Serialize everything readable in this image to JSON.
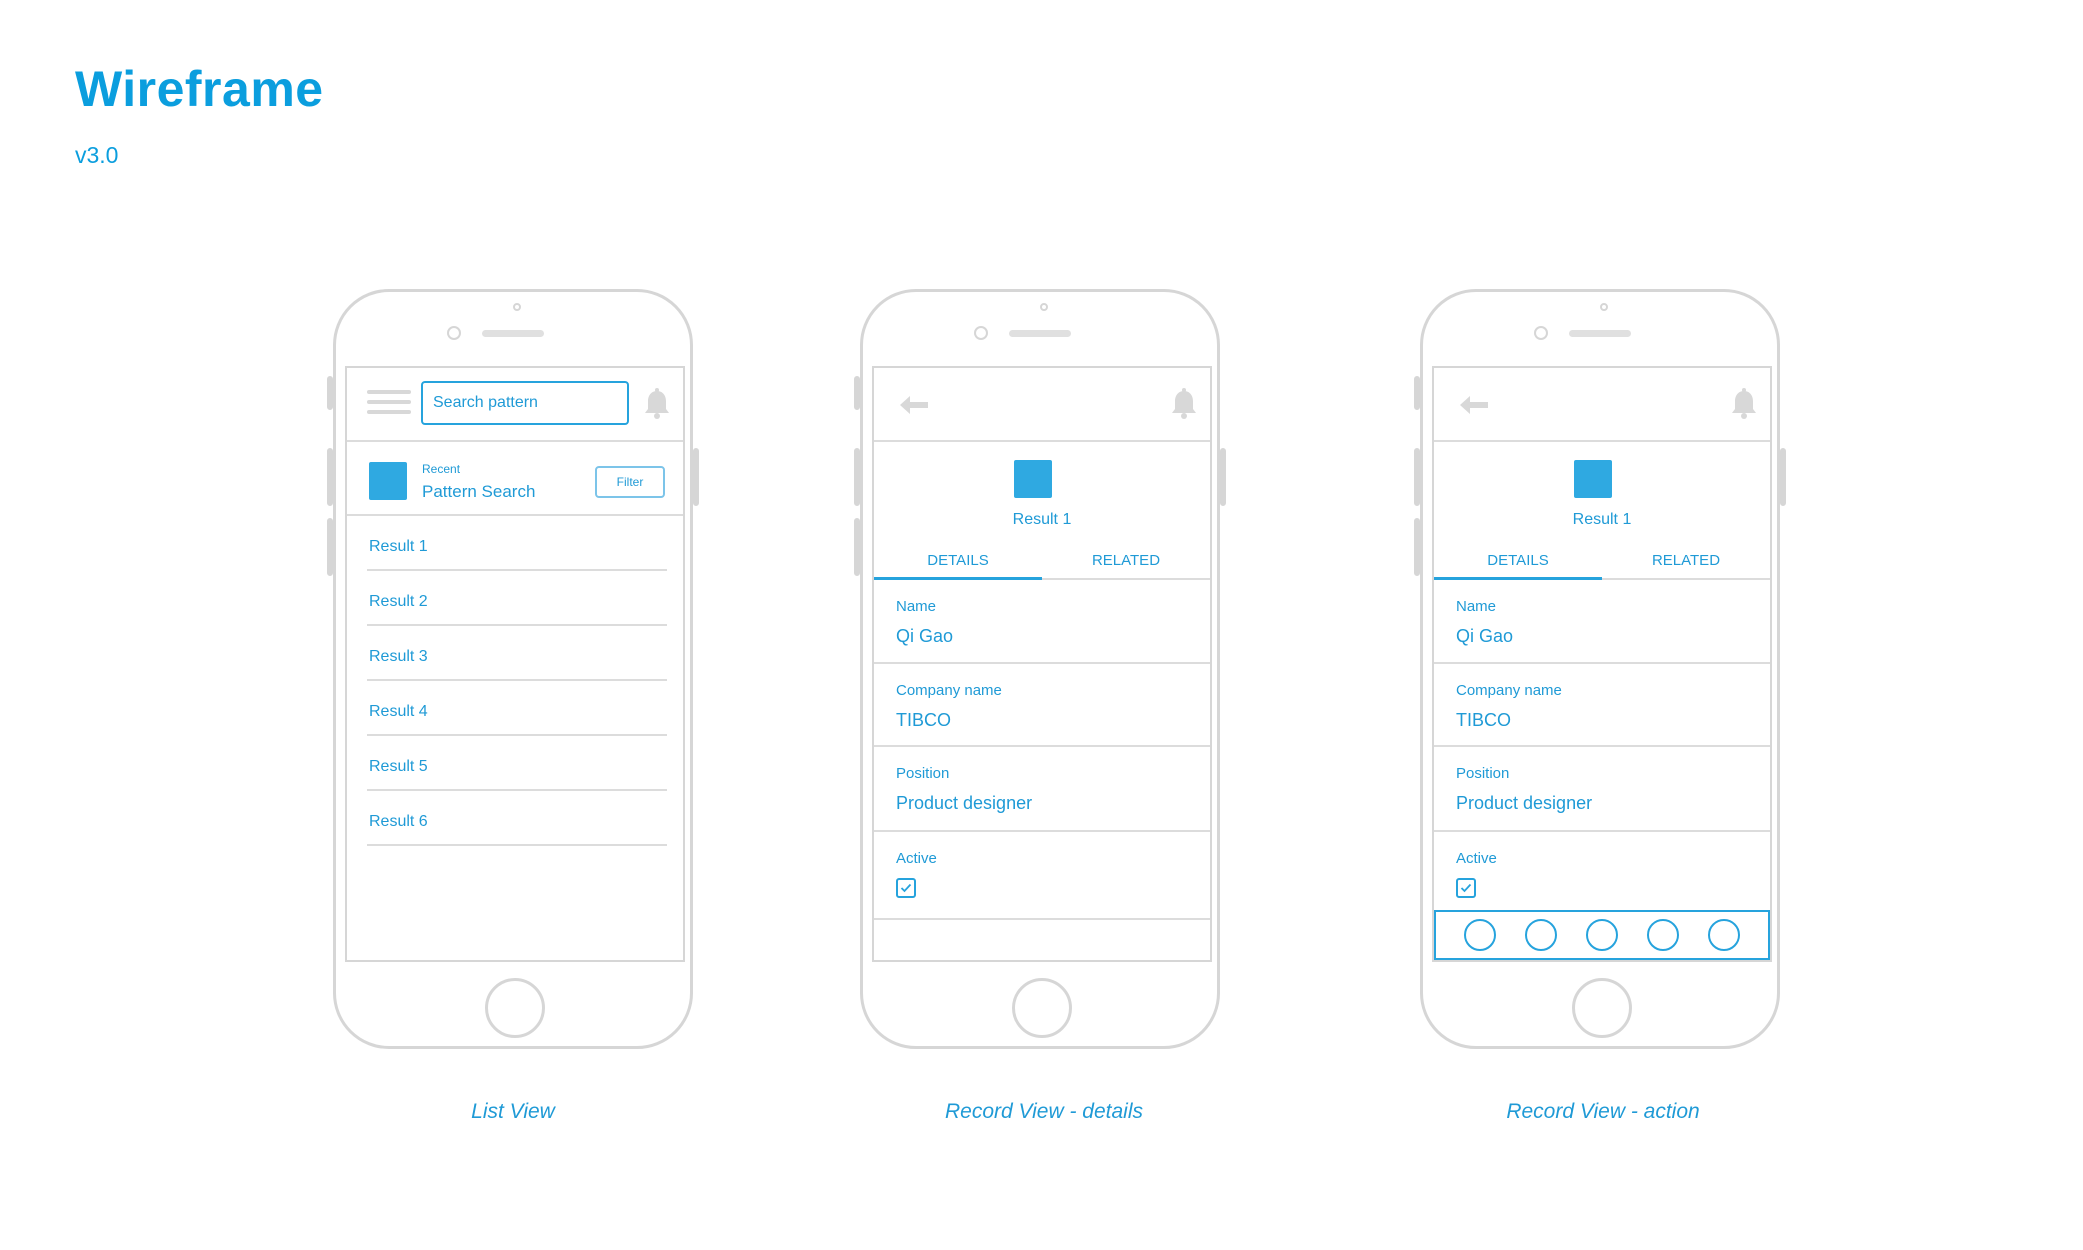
{
  "page": {
    "title": "Wireframe",
    "version": "v3.0"
  },
  "colors": {
    "accent": "#1f9ad6",
    "frame": "#d6d6d6",
    "avatar": "#2fa9e1"
  },
  "list_view": {
    "caption": "List View",
    "search": {
      "placeholder": "Search pattern"
    },
    "recent": {
      "label": "Recent",
      "value": "Pattern Search"
    },
    "filter_label": "Filter",
    "results": [
      "Result 1",
      "Result 2",
      "Result 3",
      "Result 4",
      "Result 5",
      "Result 6"
    ]
  },
  "record_details": {
    "caption": "Record View - details",
    "title": "Result 1",
    "tabs": [
      "DETAILS",
      "RELATED"
    ],
    "fields": {
      "name": {
        "label": "Name",
        "value": "Qi Gao"
      },
      "company": {
        "label": "Company name",
        "value": "TIBCO"
      },
      "position": {
        "label": "Position",
        "value": "Product designer"
      },
      "active": {
        "label": "Active",
        "checked": true
      }
    }
  },
  "record_action": {
    "caption": "Record View - action",
    "title": "Result 1",
    "tabs": [
      "DETAILS",
      "RELATED"
    ],
    "fields": {
      "name": {
        "label": "Name",
        "value": "Qi Gao"
      },
      "company": {
        "label": "Company name",
        "value": "TIBCO"
      },
      "position": {
        "label": "Position",
        "value": "Product designer"
      },
      "active": {
        "label": "Active",
        "checked": true
      }
    },
    "action_count": 5
  }
}
